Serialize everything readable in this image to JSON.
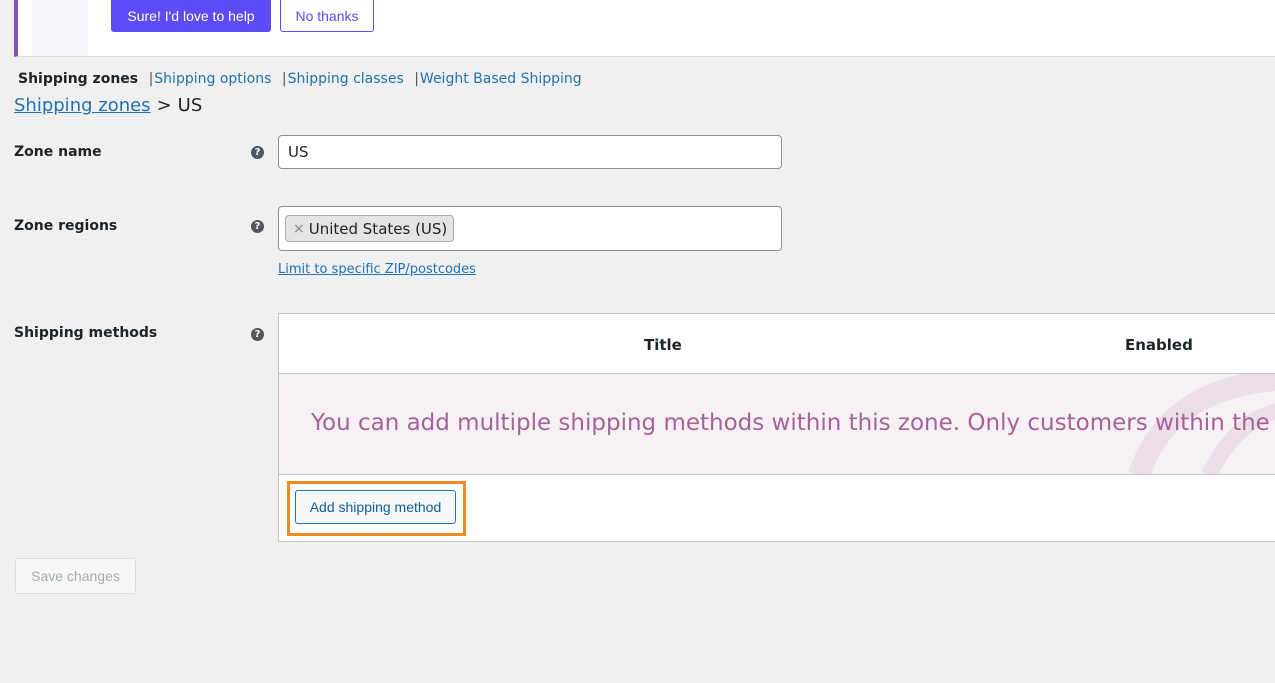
{
  "notice": {
    "primary_button": "Sure! I'd love to help",
    "secondary_button": "No thanks"
  },
  "subnav": {
    "items": [
      {
        "label": "Shipping zones",
        "current": true
      },
      {
        "label": "Shipping options",
        "current": false
      },
      {
        "label": "Shipping classes",
        "current": false
      },
      {
        "label": "Weight Based Shipping",
        "current": false
      }
    ],
    "separator": "|"
  },
  "breadcrumb": {
    "parent": "Shipping zones",
    "arrow": ">",
    "current": "US"
  },
  "form": {
    "zone_name_label": "Zone name",
    "zone_name_value": "US",
    "zone_regions_label": "Zone regions",
    "region_token": "United States (US)",
    "token_remove": "×",
    "limit_link": "Limit to specific ZIP/postcodes",
    "shipping_methods_label": "Shipping methods",
    "help_glyph": "?"
  },
  "methods_table": {
    "col_title": "Title",
    "col_enabled": "Enabled",
    "blank_message": "You can add multiple shipping methods within this zone. Only customers within the zone will see them.",
    "add_button": "Add shipping method"
  },
  "save_button": "Save changes",
  "colors": {
    "accent": "#5b4cf5",
    "link": "#2271b1",
    "blank_text": "#a46497",
    "highlight": "#f08a24"
  }
}
